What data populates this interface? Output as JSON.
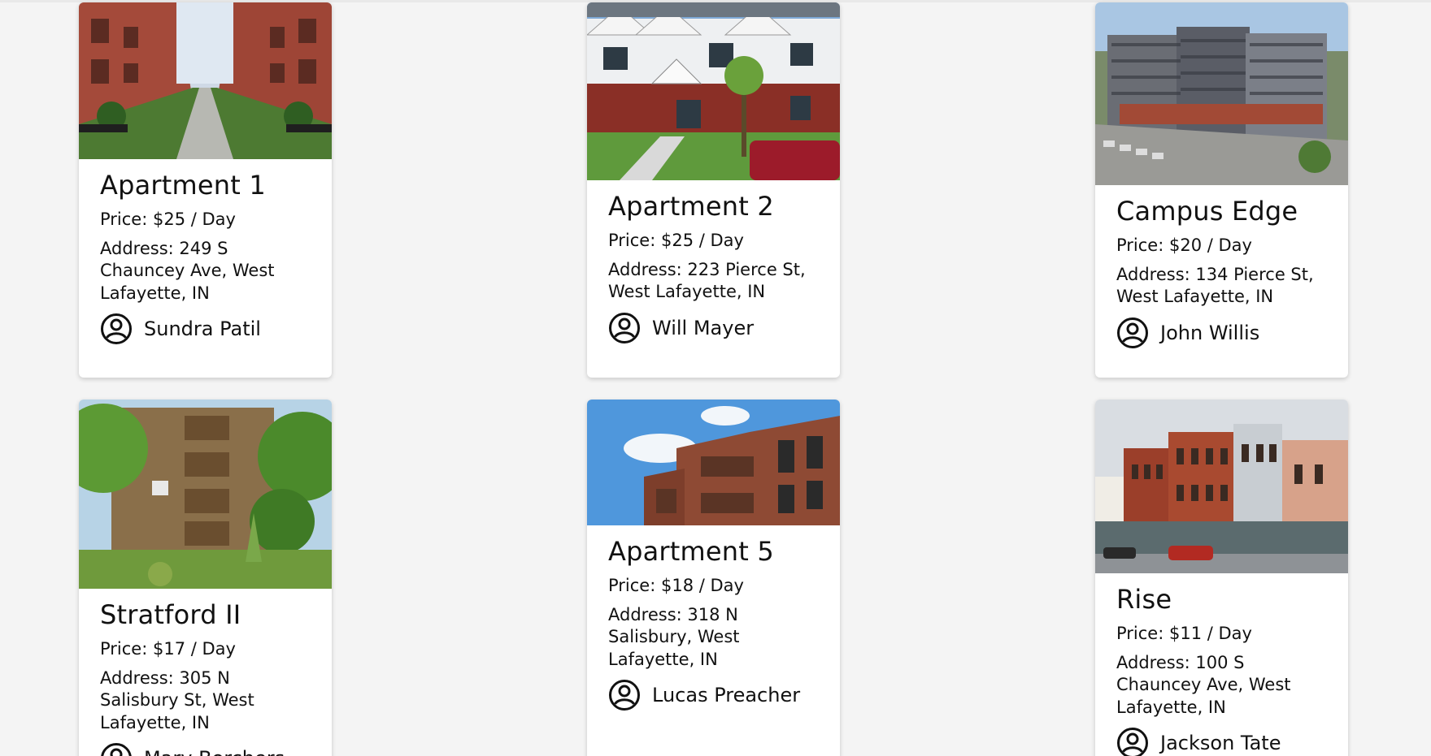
{
  "listings": [
    {
      "title": "Apartment 1",
      "price": "Price: $25 / Day",
      "address": "Address: 249 S Chauncey Ave, West Lafayette, IN",
      "owner": "Sundra Patil",
      "photo_icon": "courtyard-photo"
    },
    {
      "title": "Apartment 2",
      "price": "Price: $25 / Day",
      "address": "Address: 223 Pierce St, West Lafayette, IN",
      "owner": "Will Mayer",
      "photo_icon": "townhouse-photo"
    },
    {
      "title": "Campus Edge",
      "price": "Price: $20 / Day",
      "address": "Address: 134 Pierce St, West Lafayette, IN",
      "owner": "John Willis",
      "photo_icon": "highrise-photo"
    },
    {
      "title": "Stratford II",
      "price": "Price: $17 / Day",
      "address": "Address: 305 N Salisbury St, West Lafayette, IN",
      "owner": "Mary Borchers",
      "photo_icon": "brick-balcony-photo"
    },
    {
      "title": "Apartment 5",
      "price": "Price: $18 / Day",
      "address": "Address: 318 N Salisbury, West Lafayette, IN",
      "owner": "Lucas Preacher",
      "photo_icon": "brick-sky-photo"
    },
    {
      "title": "Rise",
      "price": "Price: $11 / Day",
      "address": "Address: 100 S Chauncey Ave, West Lafayette, IN",
      "owner": "Jackson Tate",
      "photo_icon": "storefront-photo"
    }
  ]
}
